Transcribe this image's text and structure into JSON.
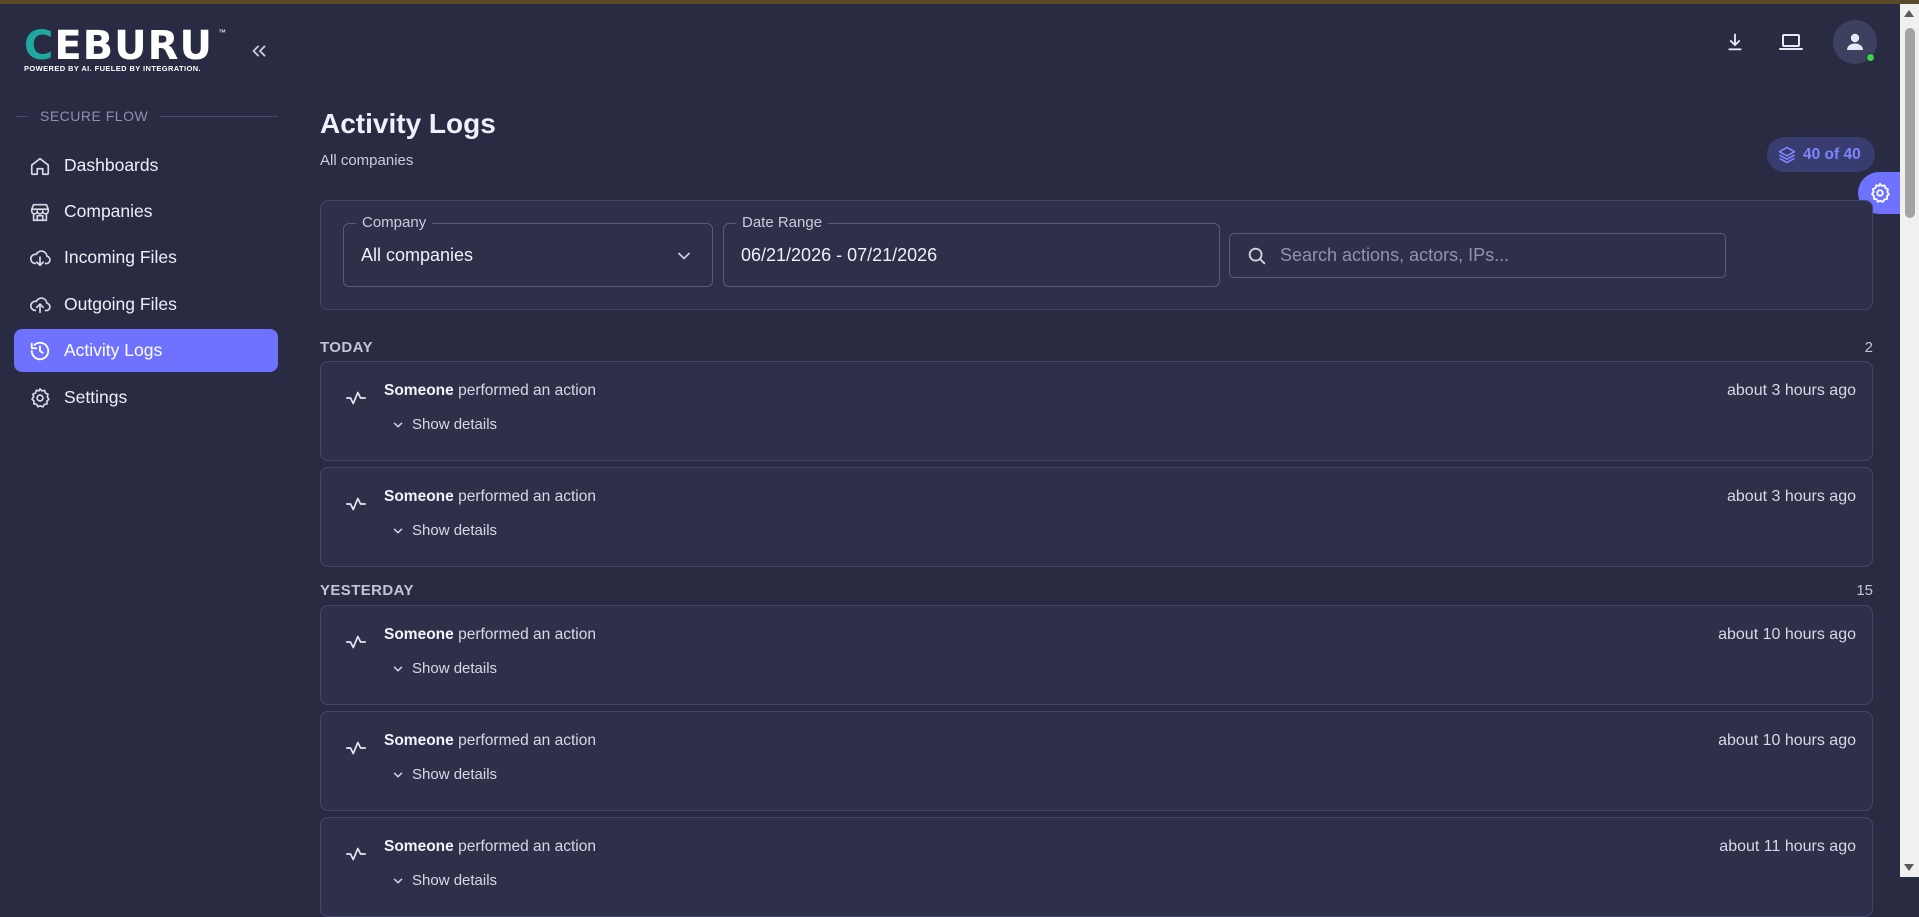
{
  "brand": {
    "logo_c": "C",
    "logo_rest": "EBURU",
    "tm": "™",
    "tagline": "POWERED BY AI. FUELED BY INTEGRATION."
  },
  "sidebar": {
    "section": "SECURE FLOW",
    "items": [
      {
        "label": "Dashboards",
        "icon": "home-icon",
        "active": false
      },
      {
        "label": "Companies",
        "icon": "store-icon",
        "active": false
      },
      {
        "label": "Incoming Files",
        "icon": "cloud-download-icon",
        "active": false
      },
      {
        "label": "Outgoing Files",
        "icon": "cloud-upload-icon",
        "active": false
      },
      {
        "label": "Activity Logs",
        "icon": "history-icon",
        "active": true
      },
      {
        "label": "Settings",
        "icon": "gear-icon",
        "active": false
      }
    ]
  },
  "header": {
    "title": "Activity Logs",
    "subtitle": "All companies",
    "count_badge": "40 of 40"
  },
  "filters": {
    "company_label": "Company",
    "company_value": "All companies",
    "date_label": "Date Range",
    "date_value": "06/21/2026 - 07/21/2026",
    "search_placeholder": "Search actions, actors, IPs..."
  },
  "groups": [
    {
      "title": "TODAY",
      "count": "2",
      "entries": [
        {
          "actor": "Someone",
          "action": "performed an action",
          "time": "about 3 hours ago",
          "details": "Show details"
        },
        {
          "actor": "Someone",
          "action": "performed an action",
          "time": "about 3 hours ago",
          "details": "Show details"
        }
      ]
    },
    {
      "title": "YESTERDAY",
      "count": "15",
      "entries": [
        {
          "actor": "Someone",
          "action": "performed an action",
          "time": "about 10 hours ago",
          "details": "Show details"
        },
        {
          "actor": "Someone",
          "action": "performed an action",
          "time": "about 10 hours ago",
          "details": "Show details"
        },
        {
          "actor": "Someone",
          "action": "performed an action",
          "time": "about 11 hours ago",
          "details": "Show details"
        }
      ]
    }
  ],
  "colors": {
    "background": "#292b43",
    "card": "#2e3049",
    "accent": "#6e72ff",
    "brand_teal": "#1fa8a0",
    "online": "#3fd04a"
  }
}
